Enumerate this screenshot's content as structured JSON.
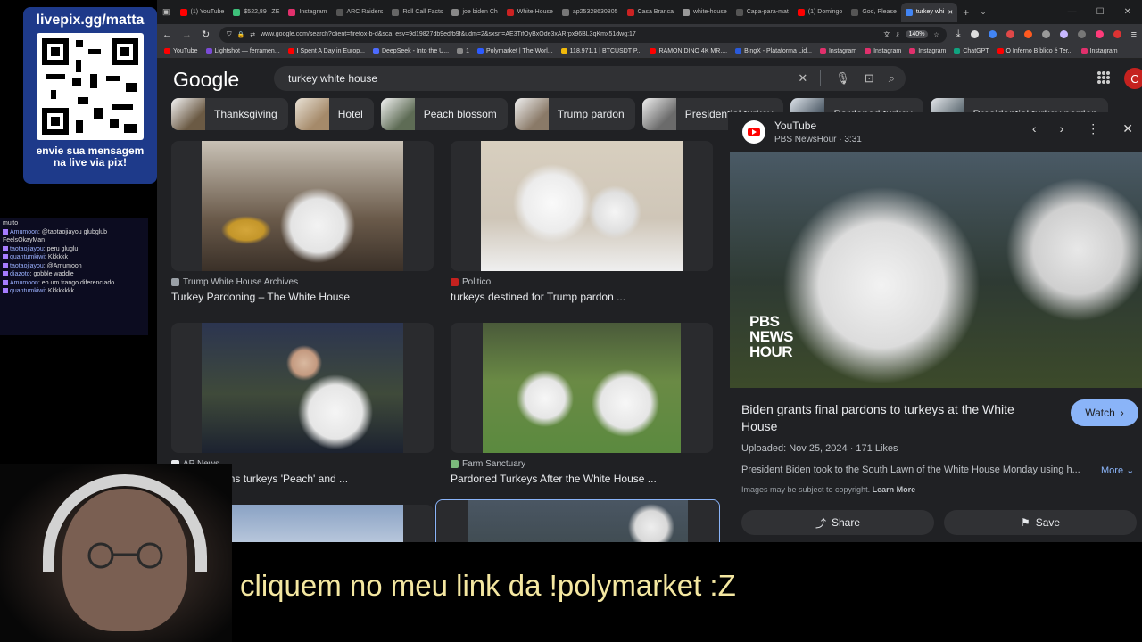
{
  "stream": {
    "qr_title": "livepix.gg/matta",
    "qr_caption": "envie sua mensagem na live via pix!",
    "subtitle": "cliquem no meu link da !polymarket :Z",
    "chat": [
      {
        "user": "",
        "text": "muito"
      },
      {
        "user": "Amumoon",
        "text": "@taotaojiayou glubglub FeelsOkayMan"
      },
      {
        "user": "taotaojiayou",
        "text": "peru gluglu"
      },
      {
        "user": "quantumkiwi",
        "text": "Kkkkkk"
      },
      {
        "user": "taotaojiayou",
        "text": "@Amumoon"
      },
      {
        "user": "diazoto",
        "text": "gobble waddle"
      },
      {
        "user": "Amumoon",
        "text": "eh um frango diferenciado"
      },
      {
        "user": "quantumkiwi",
        "text": "Kkkkkkkk"
      }
    ]
  },
  "browser": {
    "tabs": [
      {
        "label": "(1) YouTube",
        "color": "#ff0000"
      },
      {
        "label": "$522,89 | ZE",
        "color": "#3ec07a"
      },
      {
        "label": "Instagram",
        "color": "#e1306c"
      },
      {
        "label": "ARC Raiders",
        "color": "#555555"
      },
      {
        "label": "Roll Call Facts",
        "color": "#666666"
      },
      {
        "label": "joe biden Ch",
        "color": "#888888"
      },
      {
        "label": "White House",
        "color": "#cc2222"
      },
      {
        "label": "ap25328630805",
        "color": "#777777"
      },
      {
        "label": "Casa Branca",
        "color": "#cc2222"
      },
      {
        "label": "white-house",
        "color": "#999999"
      },
      {
        "label": "Capa-para-mat",
        "color": "#555555"
      },
      {
        "label": "(1) Domingo",
        "color": "#ff0000"
      },
      {
        "label": "God, Please",
        "color": "#555555"
      },
      {
        "label": "turkey whi",
        "color": "#4285f4",
        "active": true
      }
    ],
    "url": "www.google.com/search?client=firefox-b-d&sca_esv=9d19827db9edfb9f&udm=2&sxsrf=AE3TifOyBxOde3xARrpx96BL3qKmx51dwg:17",
    "zoom": "140%",
    "bookmarks": [
      {
        "label": "YouTube",
        "color": "#ff0000"
      },
      {
        "label": "Lightshot — ferramen...",
        "color": "#7b4bd6"
      },
      {
        "label": "I Spent A Day in Europ...",
        "color": "#ff0000"
      },
      {
        "label": "DeepSeek - Into the U...",
        "color": "#4d6bfe"
      },
      {
        "label": "1",
        "color": "#888888"
      },
      {
        "label": "Polymarket | The Worl...",
        "color": "#2d5bff"
      },
      {
        "label": "118.971,1 | BTCUSDT P...",
        "color": "#f0b90b"
      },
      {
        "label": "RAMON DINO 4K MR....",
        "color": "#ff0000"
      },
      {
        "label": "BingX - Plataforma Lid...",
        "color": "#2a5ada"
      },
      {
        "label": "Instagram",
        "color": "#e1306c"
      },
      {
        "label": "Instagram",
        "color": "#e1306c"
      },
      {
        "label": "Instagram",
        "color": "#e1306c"
      },
      {
        "label": "ChatGPT",
        "color": "#10a37f"
      },
      {
        "label": "O Inferno Bíblico é Ter...",
        "color": "#ff0000"
      },
      {
        "label": "Instagram",
        "color": "#e1306c"
      }
    ]
  },
  "google": {
    "logo": "Google",
    "query": "turkey white house",
    "avatar_letter": "C",
    "chips": [
      {
        "label": "Thanksgiving",
        "color": "#6b5a44"
      },
      {
        "label": "Hotel",
        "color": "#a58a6a"
      },
      {
        "label": "Peach blossom",
        "color": "#5e6c55"
      },
      {
        "label": "Trump pardon",
        "color": "#8a7a68"
      },
      {
        "label": "Presidential turkey",
        "color": "#6b6b6b"
      },
      {
        "label": "Pardoned turkey",
        "color": "#4d5a66"
      },
      {
        "label": "Presidential turkey pardon",
        "color": "#5d6a72"
      }
    ],
    "results": [
      {
        "source": "Trump White House Archives",
        "title": "Turkey Pardoning – The White House",
        "fav": "#9aa0a6",
        "img": "#6a5a4a"
      },
      {
        "source": "Politico",
        "title": "turkeys destined for Trump pardon ...",
        "fav": "#c5221f",
        "img": "#cfc6b8"
      },
      {
        "source": "AP News",
        "title": "Biden pardons turkeys 'Peach' and ...",
        "fav": "#e8eaed",
        "img": "#3f4a3a"
      },
      {
        "source": "Farm Sanctuary",
        "title": "Pardoned Turkeys After the White House ...",
        "fav": "#7bb97b",
        "img": "#5b8a3f"
      },
      {
        "source": "",
        "title": "",
        "fav": "#9aa0a6",
        "img": "#8aa2c4"
      },
      {
        "source": "",
        "title": "",
        "fav": "#9aa0a6",
        "img": "#4a5663"
      }
    ]
  },
  "panel": {
    "source": "YouTube",
    "sub": "PBS NewsHour · 3:31",
    "pbs_logo": "PBS NEWS HOUR",
    "title": "Biden grants final pardons to turkeys at the White House",
    "watch_label": "Watch",
    "meta": "Uploaded: Nov 25, 2024 · 171 Likes",
    "description": "President Biden took to the South Lawn of the White House Monday using h...",
    "more_label": "More",
    "copyright": "Images may be subject to copyright.",
    "learn_more": "Learn More",
    "share_label": "Share",
    "save_label": "Save"
  }
}
